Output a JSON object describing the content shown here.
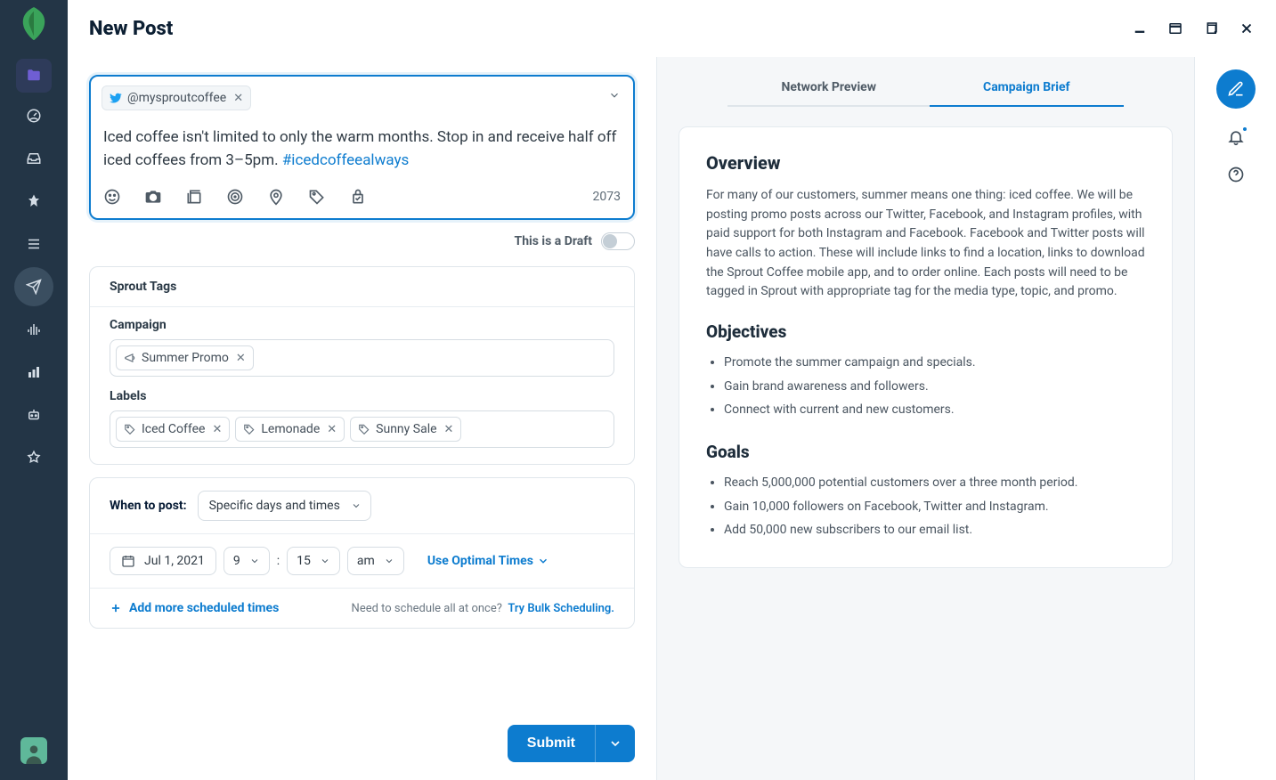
{
  "header": {
    "title": "New Post"
  },
  "compose": {
    "account_handle": "@mysproutcoffee",
    "body_text": "Iced coffee isn't limited to only the warm months. Stop in and receive half off iced coffees from 3–5pm. ",
    "hashtag": "#icedcoffeealways",
    "char_count": "2073"
  },
  "draft_label": "This is a Draft",
  "tags_section": {
    "title": "Sprout Tags",
    "campaign_label": "Campaign",
    "campaign_tag": "Summer Promo",
    "labels_label": "Labels",
    "labels": [
      "Iced Coffee",
      "Lemonade",
      "Sunny Sale"
    ]
  },
  "schedule": {
    "when_label": "When to post:",
    "mode": "Specific days and times",
    "date": "Jul 1, 2021",
    "hour": "9",
    "minute": "15",
    "ampm": "am",
    "optimal": "Use Optimal Times",
    "add_more": "Add more scheduled times",
    "bulk_prompt": "Need to schedule all at once?",
    "bulk_link": "Try Bulk Scheduling."
  },
  "submit_label": "Submit",
  "tabs": {
    "preview": "Network Preview",
    "brief": "Campaign Brief"
  },
  "brief": {
    "overview_h": "Overview",
    "overview_p": "For many of our customers, summer means one thing: iced coffee. We will be posting promo posts across our Twitter, Facebook, and Instagram profiles, with paid support for both Instagram and Facebook. Facebook and Twitter posts will have calls to action. These will include links to find a location, links to download the Sprout Coffee mobile app, and to order online. Each posts will need to be tagged in Sprout with appropriate tag for the media type, topic, and promo.",
    "objectives_h": "Objectives",
    "objectives": [
      "Promote the summer campaign and specials.",
      "Gain brand awareness and followers.",
      "Connect with current and new customers."
    ],
    "goals_h": "Goals",
    "goals": [
      "Reach 5,000,000 potential customers over a three month period.",
      "Gain 10,000 followers on Facebook, Twitter and Instagram.",
      "Add 50,000 new subscribers to our email list."
    ]
  }
}
